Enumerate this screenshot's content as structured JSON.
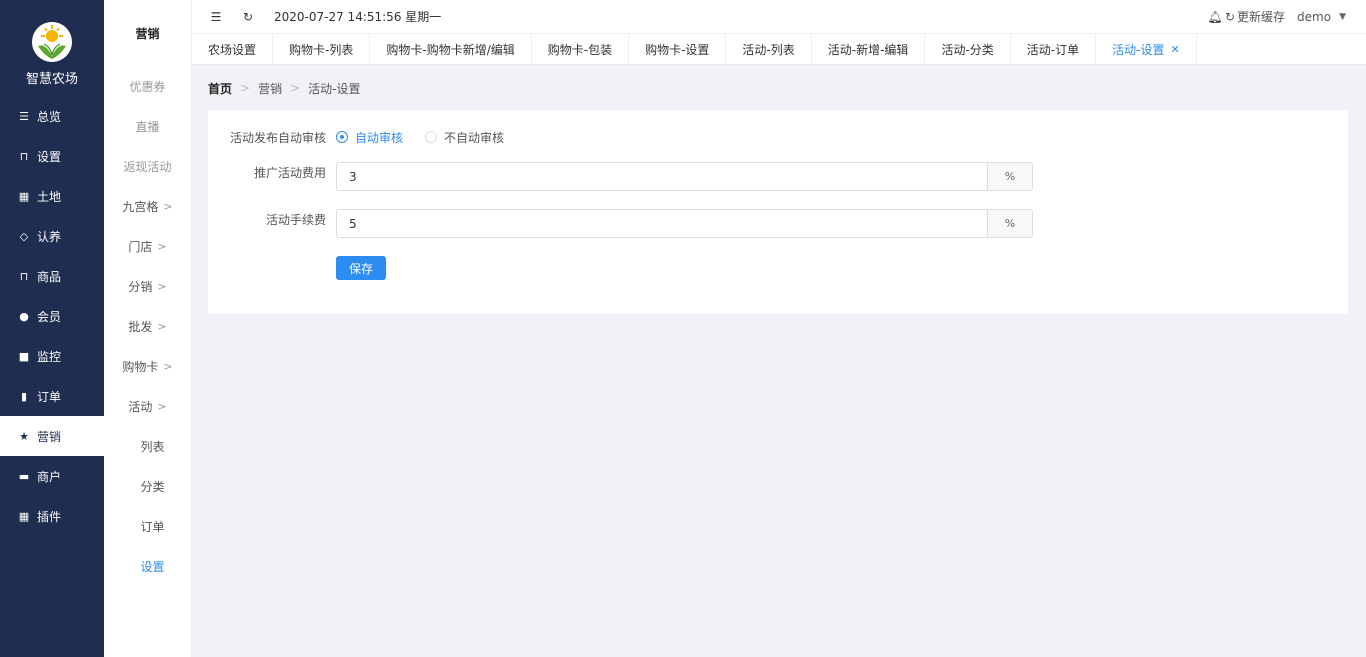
{
  "app": {
    "title": "智慧农场"
  },
  "sidebar": {
    "items": [
      {
        "label": "总览",
        "icon": "sliders-icon"
      },
      {
        "label": "设置",
        "icon": "bag-icon"
      },
      {
        "label": "土地",
        "icon": "grid-icon"
      },
      {
        "label": "认养",
        "icon": "diamond-icon"
      },
      {
        "label": "商品",
        "icon": "bag-icon"
      },
      {
        "label": "会员",
        "icon": "user-icon"
      },
      {
        "label": "监控",
        "icon": "camera-icon"
      },
      {
        "label": "订单",
        "icon": "clipboard-icon"
      },
      {
        "label": "营销",
        "icon": "star-icon",
        "active": true
      },
      {
        "label": "商户",
        "icon": "store-icon"
      },
      {
        "label": "插件",
        "icon": "grid-icon"
      }
    ]
  },
  "submenu": {
    "title": "营销",
    "items": [
      {
        "label": "优惠券"
      },
      {
        "label": "直播"
      },
      {
        "label": "返现活动"
      },
      {
        "label": "九宫格"
      },
      {
        "label": "门店"
      },
      {
        "label": "分销"
      },
      {
        "label": "批发"
      },
      {
        "label": "购物卡"
      },
      {
        "label": "活动"
      },
      {
        "label": "列表"
      },
      {
        "label": "分类"
      },
      {
        "label": "订单"
      },
      {
        "label": "设置"
      }
    ]
  },
  "topbar": {
    "datetime": "2020-07-27 14:51:56 星期一",
    "refresh_cache": "更新缓存",
    "user": "demo"
  },
  "tabs": [
    {
      "label": "农场设置"
    },
    {
      "label": "购物卡-列表"
    },
    {
      "label": "购物卡-购物卡新增/编辑"
    },
    {
      "label": "购物卡-包装"
    },
    {
      "label": "购物卡-设置"
    },
    {
      "label": "活动-列表"
    },
    {
      "label": "活动-新增-编辑"
    },
    {
      "label": "活动-分类"
    },
    {
      "label": "活动-订单"
    },
    {
      "label": "活动-设置",
      "active": true
    }
  ],
  "breadcrumb": {
    "home": "首页",
    "level1": "营销",
    "level2": "活动-设置"
  },
  "form": {
    "auto_review": {
      "label": "活动发布自动审核",
      "options": [
        "自动审核",
        "不自动审核"
      ],
      "selected": "自动审核"
    },
    "promo_fee": {
      "label": "推广活动费用",
      "value": "3",
      "unit": "%"
    },
    "handling_fee": {
      "label": "活动手续费",
      "value": "5",
      "unit": "%"
    },
    "save_label": "保存"
  },
  "colors": {
    "sidebar_bg": "#1f2d50",
    "accent": "#2d8cf0"
  }
}
